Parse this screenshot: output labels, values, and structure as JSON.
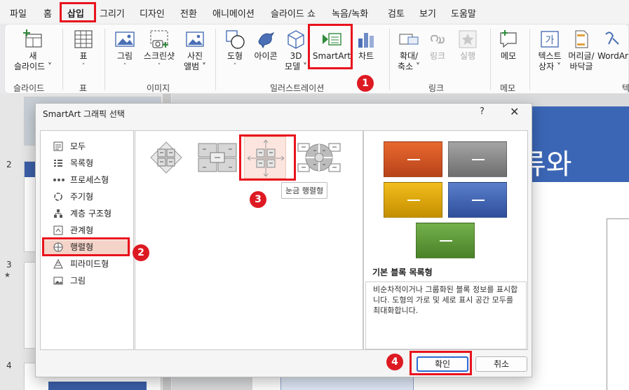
{
  "menu": [
    "파일",
    "홈",
    "삽입",
    "그리기",
    "디자인",
    "전환",
    "애니메이션",
    "슬라이드 쇼",
    "녹음/녹화",
    "검토",
    "보기",
    "도움말"
  ],
  "ribbon": {
    "new_slide": [
      "새",
      "슬라이드 ˅"
    ],
    "table": [
      "표",
      "˅"
    ],
    "picture": [
      "그림",
      "˅"
    ],
    "screenshot": [
      "스크린샷",
      "˅"
    ],
    "photo_album": [
      "사진",
      "앨범 ˅"
    ],
    "shapes": [
      "도형",
      "˅"
    ],
    "icons": "아이콘",
    "models3d": [
      "3D",
      "모델 ˅"
    ],
    "smartart": "SmartArt",
    "chart": "차트",
    "zoom": [
      "확대/",
      "축소 ˅"
    ],
    "link": "링크",
    "action": "실행",
    "comment": "메모",
    "textbox": [
      "텍스트",
      "상자 ˅"
    ],
    "header_footer": [
      "머리글/",
      "바닥글"
    ],
    "wordart": "WordAr",
    "groups": [
      "슬라이드",
      "표",
      "이미지",
      "일러스트레이션",
      "링크",
      "메모",
      "텍"
    ]
  },
  "slides_pane": {
    "numbers": [
      "2",
      "3",
      "4"
    ],
    "star": "★"
  },
  "slide": {
    "title_fragment": "류와"
  },
  "dialog": {
    "title": "SmartArt 그래픽 선택",
    "help": "?",
    "close": "✕",
    "categories": [
      "모두",
      "목록형",
      "프로세스형",
      "주기형",
      "계층 구조형",
      "관계형",
      "행렬형",
      "피라미드형",
      "그림"
    ],
    "selected_category": "행렬형",
    "tooltip": "눈금 행렬형",
    "preview_name": "기본 블록 목록형",
    "preview_desc": "비순차적이거나 그룹화된 블록 정보를 표시합니다. 도형의 가로 및 세로 표시 공간 모두를 최대화합니다.",
    "ok": "확인",
    "cancel": "취소"
  },
  "steps": [
    "1",
    "2",
    "3",
    "4"
  ],
  "colors": {
    "accent": "#c43e1c",
    "highlight": "#e8131d",
    "preview_blocks": [
      "#d9541e",
      "#8c8c8c",
      "#e0a900",
      "#3f63b8",
      "#5e9a3a"
    ]
  }
}
